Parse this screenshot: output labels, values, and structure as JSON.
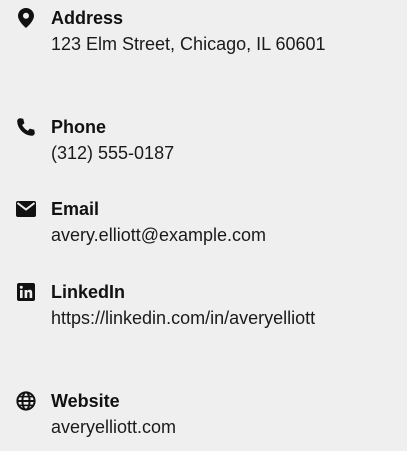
{
  "contact": {
    "items": [
      {
        "icon": "map-marker-icon",
        "label": "Address",
        "value": "123 Elm Street, Chicago, IL 60601"
      },
      {
        "icon": "phone-icon",
        "label": "Phone",
        "value": "(312) 555-0187"
      },
      {
        "icon": "envelope-icon",
        "label": "Email",
        "value": "avery.elliott@example.com"
      },
      {
        "icon": "linkedin-icon",
        "label": "LinkedIn",
        "value": "https://linkedin.com/in/averyelliott"
      },
      {
        "icon": "globe-icon",
        "label": "Website",
        "value": "averyelliott.com"
      }
    ]
  }
}
